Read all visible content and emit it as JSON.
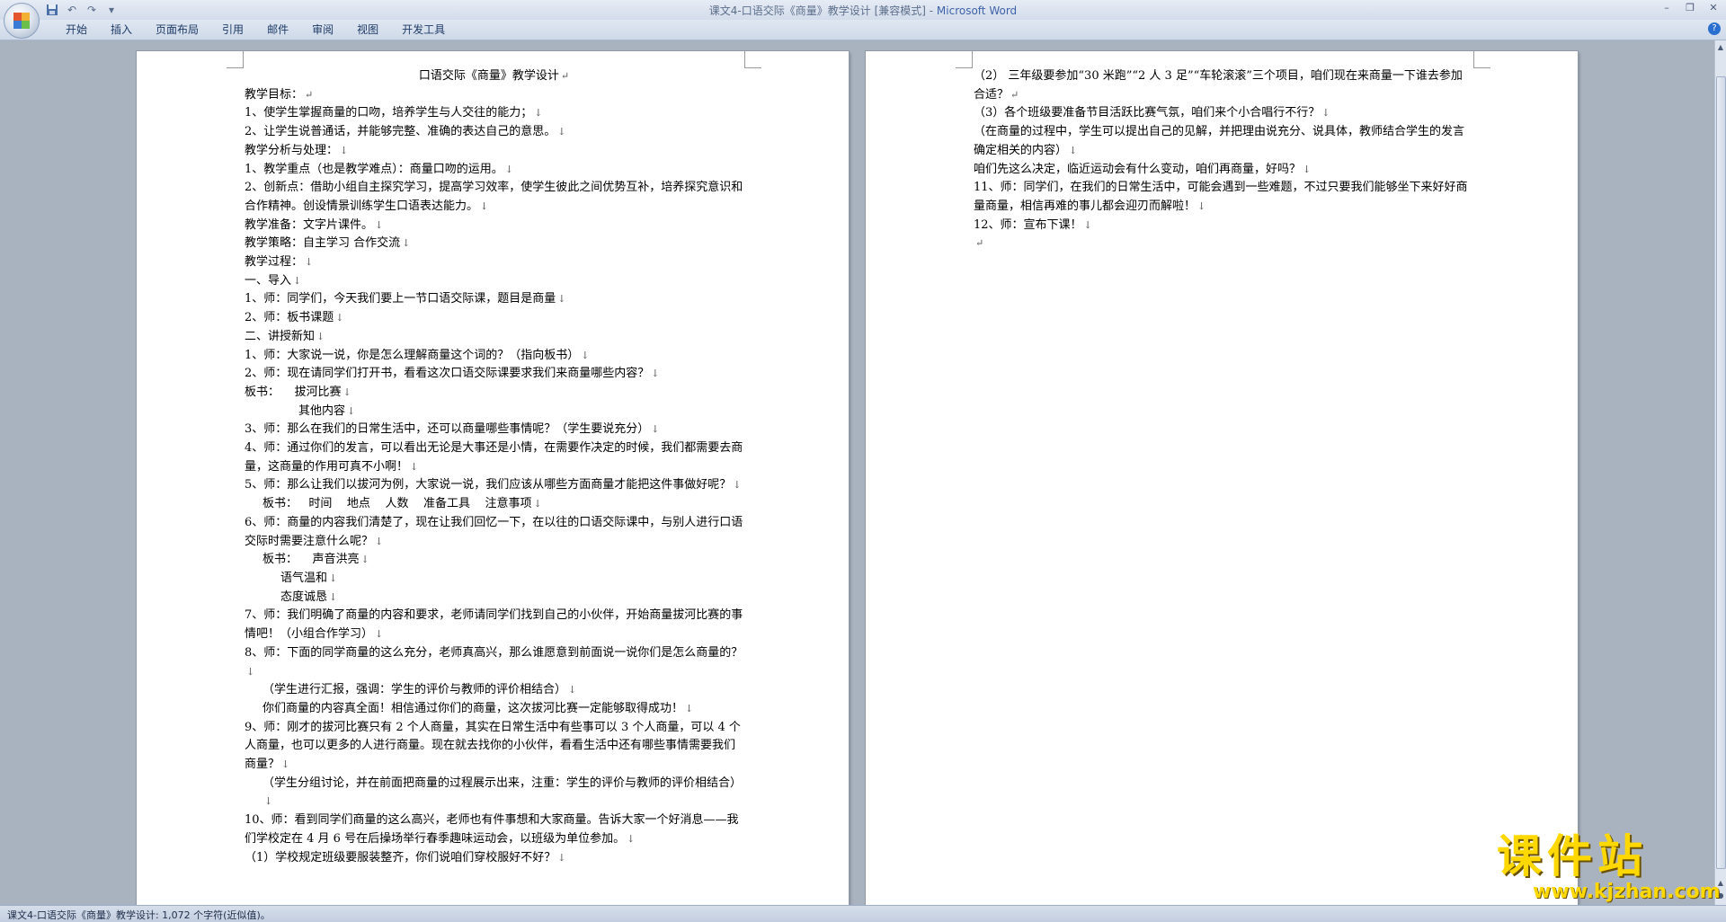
{
  "window": {
    "title_doc": "课文4-口语交际《商量》教学设计 [兼容模式] - ",
    "title_app": "Microsoft Word",
    "minimize_glyph": "–",
    "restore_glyph": "❐",
    "close_glyph": "✕"
  },
  "qat": {
    "save_icon": "save-icon",
    "undo_icon": "undo-icon",
    "redo_icon": "redo-icon",
    "customize_icon": "dropdown-icon"
  },
  "ribbon": {
    "tabs": [
      "开始",
      "插入",
      "页面布局",
      "引用",
      "邮件",
      "审阅",
      "视图",
      "开发工具"
    ]
  },
  "page_left": {
    "lines": [
      "口语交际《商量》教学设计",
      "教学目标：",
      "1、使学生掌握商量的口吻，培养学生与人交往的能力；",
      "2、让学生说普通话，并能够完整、准确的表达自己的意思。",
      "教学分析与处理：",
      "1、教学重点（也是教学难点）：商量口吻的运用。",
      "2、创新点：借助小组自主探究学习，提高学习效率，使学生彼此之间优势互补，培养探究意识和合作精神。创设情景训练学生口语表达能力。",
      "教学准备：文字片课件。",
      "教学策略：自主学习 合作交流",
      "教学过程：",
      "一、导入",
      "1、师：同学们，今天我们要上一节口语交际课，题目是商量",
      "2、师：板书课题",
      "二、讲授新知",
      "1、师：大家说一说，你是怎么理解商量这个词的？（指向板书）",
      "2、师：现在请同学们打开书，看看这次口语交际课要求我们来商量哪些内容？",
      "板书：    拔河比赛",
      "其他内容",
      "3、师：那么在我们的日常生活中，还可以商量哪些事情呢？（学生要说充分）",
      "4、师：通过你们的发言，可以看出无论是大事还是小情，在需要作决定的时候，我们都需要去商量，这商量的作用可真不小啊！",
      "5、师：那么让我们以拔河为例，大家说一说，我们应该从哪些方面商量才能把这件事做好呢？",
      "板书：   时间    地点    人数    准备工具    注意事项",
      "6、师：商量的内容我们清楚了，现在让我们回忆一下，在以往的口语交际课中，与别人进行口语交际时需要注意什么呢？",
      "板书：    声音洪亮",
      "语气温和",
      "态度诚恳",
      "7、师：我们明确了商量的内容和要求，老师请同学们找到自己的小伙伴，开始商量拔河比赛的事情吧！（小组合作学习）",
      "8、师：下面的同学商量的这么充分，老师真高兴，那么谁愿意到前面说一说你们是怎么商量的？",
      "（学生进行汇报，强调：学生的评价与教师的评价相结合）",
      "你们商量的内容真全面！相信通过你们的商量，这次拔河比赛一定能够取得成功！",
      "9、师：刚才的拔河比赛只有 2 个人商量，其实在日常生活中有些事可以 3 个人商量，可以 4 个人商量，也可以更多的人进行商量。现在就去找你的小伙伴，看看生活中还有哪些事情需要我们商量？",
      "（学生分组讨论，并在前面把商量的过程展示出来，注重：学生的评价与教师的评价相结合）",
      "10、师：看到同学们商量的这么高兴，老师也有件事想和大家商量。告诉大家一个好消息——我们学校定在 4 月 6 号在后操场举行春季趣味运动会，以班级为单位参加。",
      "（1）学校规定班级要服装整齐，你们说咱们穿校服好不好？"
    ]
  },
  "page_right": {
    "lines": [
      "（2） 三年级要参加“30 米跑”“2 人 3 足”“车轮滚滚”三个项目，咱们现在来商量一下谁去参加合适？",
      "（3）各个班级要准备节目活跃比赛气氛，咱们来个小合唱行不行？",
      "（在商量的过程中，学生可以提出自己的见解，并把理由说充分、说具体，教师结合学生的发言确定相关的内容）",
      "咱们先这么决定，临近运动会有什么变动，咱们再商量，好吗？",
      "11、师：同学们，在我们的日常生活中，可能会遇到一些难题，不过只要我们能够坐下来好好商量商量，相信再难的事儿都会迎刃而解啦！",
      "12、师：宣布下课！",
      ""
    ]
  },
  "marks": {
    "paragraph": "↵",
    "line_break": "↓"
  },
  "status": {
    "text": "课文4-口语交际《商量》教学设计: 1,072 个字符(近似值)。"
  },
  "watermark": {
    "main": "课件站",
    "url": "www.kjzhan.com"
  },
  "colors": {
    "title_app": "#3e63a8",
    "workspace": "#a9b2bf",
    "watermark": "#ffd800"
  }
}
